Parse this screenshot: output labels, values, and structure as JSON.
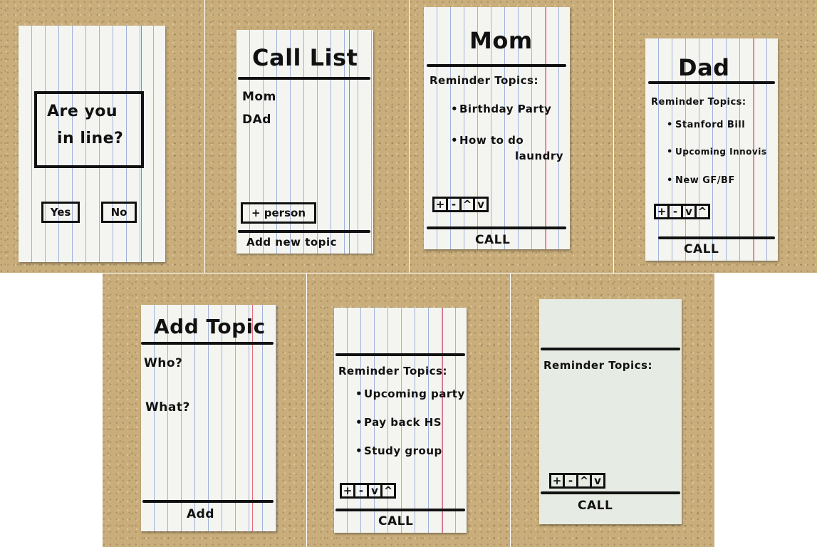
{
  "screen1": {
    "dialog_text_line1": "Are you",
    "dialog_text_line2": "in line?",
    "yes_label": "Yes",
    "no_label": "No"
  },
  "screen2": {
    "title": "Call List",
    "contacts": [
      "Mom",
      "DAd"
    ],
    "add_person_label": "+ person",
    "footer_label": "Add new topic"
  },
  "screen3": {
    "title": "Mom",
    "heading": "Reminder Topics:",
    "topics": [
      "Birthday Party",
      "How to do",
      "laundry"
    ],
    "controls": [
      "+",
      "-",
      "^",
      "v"
    ],
    "footer_label": "CALL"
  },
  "screen4": {
    "title": "Dad",
    "heading": "Reminder Topics:",
    "topics": [
      "Stanford Bill",
      "Upcoming Innovis",
      "New GF/BF"
    ],
    "controls": [
      "+",
      "-",
      "v",
      "^"
    ],
    "footer_label": "CALL"
  },
  "screen5": {
    "title": "Add Topic",
    "who_label": "Who?",
    "what_label": "What?",
    "footer_label": "Add"
  },
  "screen6": {
    "heading": "Reminder Topics:",
    "topics": [
      "Upcoming party",
      "Pay back HS",
      "Study group"
    ],
    "controls": [
      "+",
      "-",
      "v",
      "^"
    ],
    "footer_label": "CALL"
  },
  "screen7": {
    "heading": "Reminder Topics:",
    "controls": [
      "+",
      "-",
      "^",
      "v"
    ],
    "footer_label": "CALL"
  }
}
